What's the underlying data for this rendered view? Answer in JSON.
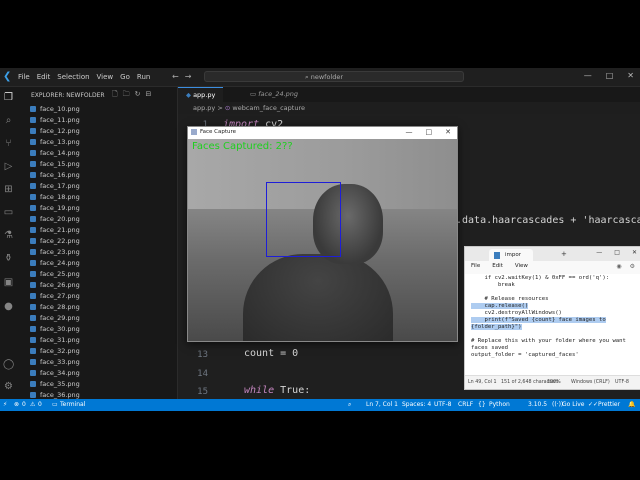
{
  "menu": [
    "File",
    "Edit",
    "Selection",
    "View",
    "Go",
    "Run"
  ],
  "title_search": "newfolder",
  "explorer_title": "EXPLORER: NEWFOLDER",
  "files": [
    "face_10.png",
    "face_11.png",
    "face_12.png",
    "face_13.png",
    "face_14.png",
    "face_15.png",
    "face_16.png",
    "face_17.png",
    "face_18.png",
    "face_19.png",
    "face_20.png",
    "face_21.png",
    "face_22.png",
    "face_23.png",
    "face_24.png",
    "face_25.png",
    "face_26.png",
    "face_27.png",
    "face_28.png",
    "face_29.png",
    "face_30.png",
    "face_31.png",
    "face_32.png",
    "face_33.png",
    "face_34.png",
    "face_35.png",
    "face_36.png"
  ],
  "tabs": {
    "active": "app.py",
    "inactive": "face_24.png"
  },
  "breadcrumb": {
    "file": "app.py",
    "separator": ">",
    "symbol": "webcam_face_capture"
  },
  "code": {
    "line1_num": "1",
    "line1_kw": "import",
    "line1_rest": " cv2",
    "haar_text": ".data.haarcascades + 'haarcascade_f",
    "line13_num": "13",
    "line13_text": "count = 0",
    "line14_num": "14",
    "line15_num": "15",
    "line15_kw": "while",
    "line15_rest": " True:"
  },
  "face_window": {
    "title": "Face Capture",
    "overlay": "Faces Captured: 2??"
  },
  "notepad": {
    "tab": "impor",
    "menu": [
      "File",
      "Edit",
      "View"
    ],
    "lines": [
      "    if cv2.waitKey(1) & 0xFF == ord('q'):",
      "        break",
      "",
      "    # Release resources",
      "    cap.release()",
      "    cv2.destroyAllWindows()",
      "    print(f\"Saved {count} face images to",
      "{folder_path}\")",
      "",
      "# Replace this with your folder where you want",
      "faces saved",
      "output_folder = 'captured_faces'"
    ],
    "status": {
      "pos": "Ln 49, Col 1",
      "chars": "151 of 2,648 characters",
      "zoom": "100%",
      "eol": "Windows (CRLF)",
      "enc": "UTF-8"
    }
  },
  "statusbar": {
    "errors": "0",
    "warnings": "0",
    "terminal": "Terminal",
    "pos": "Ln 7, Col 1",
    "spaces": "Spaces: 4",
    "enc": "UTF-8",
    "eol": "CRLF",
    "lang": "Python",
    "version": "3.10.5",
    "golive": "Go Live",
    "profiler": "Prettier"
  },
  "colors": {
    "accent": "#0078d4",
    "overlay_text": "#1fd01f",
    "face_box": "#1e1ed8"
  }
}
